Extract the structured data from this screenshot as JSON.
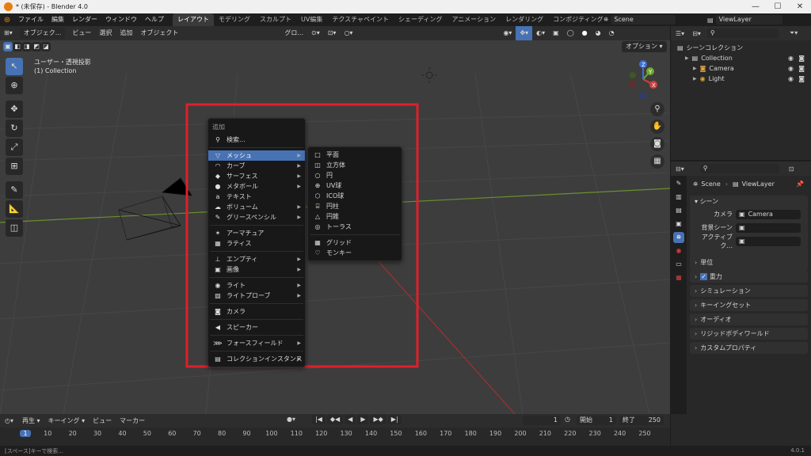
{
  "window": {
    "title": "* (未保存) - Blender 4.0",
    "min_glyph": "—",
    "max_glyph": "☐",
    "close_glyph": "✕"
  },
  "menubar": {
    "menus": [
      "ファイル",
      "編集",
      "レンダー",
      "ウィンドウ",
      "ヘルプ"
    ],
    "workspaces": [
      "レイアウト",
      "モデリング",
      "スカルプト",
      "UV編集",
      "テクスチャペイント",
      "シェーディング",
      "アニメーション",
      "レンダリング",
      "コンポジティング"
    ],
    "active_workspace": "レイアウト",
    "scene": "Scene",
    "view_layer": "ViewLayer"
  },
  "viewport_header": {
    "mode": "オブジェク...",
    "menus": [
      "ビュー",
      "選択",
      "追加",
      "オブジェクト"
    ],
    "transform": "グロ...",
    "options_label": "オプション"
  },
  "viewport": {
    "view_label": "ユーザー・透視投影",
    "collection_label": "(1) Collection",
    "gizmo_axes": [
      "X",
      "Y",
      "Z"
    ]
  },
  "add_menu": {
    "title": "追加",
    "search": "検索...",
    "items": [
      {
        "label": "メッシュ",
        "icon": "▽",
        "sub": true,
        "hl": true
      },
      {
        "label": "カーブ",
        "icon": "◠",
        "sub": true
      },
      {
        "label": "サーフェス",
        "icon": "◆",
        "sub": true
      },
      {
        "label": "メタボール",
        "icon": "●",
        "sub": true
      },
      {
        "label": "テキスト",
        "icon": "a",
        "sub": false
      },
      {
        "label": "ボリューム",
        "icon": "☁",
        "sub": true
      },
      {
        "label": "グリースペンシル",
        "icon": "✎",
        "sub": true
      },
      {
        "label": "アーマチュア",
        "icon": "✶",
        "sub": false
      },
      {
        "label": "ラティス",
        "icon": "▦",
        "sub": false
      },
      {
        "label": "エンプティ",
        "icon": "⊥",
        "sub": true
      },
      {
        "label": "画像",
        "icon": "▣",
        "sub": true
      },
      {
        "label": "ライト",
        "icon": "◉",
        "sub": true
      },
      {
        "label": "ライトプローブ",
        "icon": "▨",
        "sub": true
      },
      {
        "label": "カメラ",
        "icon": "◙",
        "sub": false
      },
      {
        "label": "スピーカー",
        "icon": "◀",
        "sub": false
      },
      {
        "label": "フォースフィールド",
        "icon": "⋙",
        "sub": true
      },
      {
        "label": "コレクションインスタンス",
        "icon": "▤",
        "sub": true
      }
    ]
  },
  "mesh_submenu": {
    "items": [
      {
        "label": "平面",
        "icon": "□"
      },
      {
        "label": "立方体",
        "icon": "◫"
      },
      {
        "label": "円",
        "icon": "○"
      },
      {
        "label": "UV球",
        "icon": "⊕"
      },
      {
        "label": "ICO球",
        "icon": "⬡"
      },
      {
        "label": "円柱",
        "icon": "⌸"
      },
      {
        "label": "円錐",
        "icon": "△"
      },
      {
        "label": "トーラス",
        "icon": "◎"
      },
      {
        "label": "グリッド",
        "icon": "▦"
      },
      {
        "label": "モンキー",
        "icon": "♡"
      }
    ]
  },
  "outliner": {
    "title": "シーンコレクション",
    "items": [
      {
        "label": "Collection",
        "indent": 1
      },
      {
        "label": "Camera",
        "indent": 2
      },
      {
        "label": "Light",
        "indent": 2
      }
    ]
  },
  "properties": {
    "breadcrumb_scene": "Scene",
    "breadcrumb_layer": "ViewLayer",
    "panel_title": "シーン",
    "fields": [
      {
        "label": "カメラ",
        "value": "Camera"
      },
      {
        "label": "背景シーン",
        "value": ""
      },
      {
        "label": "アクティブク...",
        "value": ""
      }
    ],
    "sections": [
      "単位",
      "重力",
      "シミュレーション",
      "キーイングセット",
      "オーディオ",
      "リジッドボディワールド",
      "カスタムプロパティ"
    ]
  },
  "timeline": {
    "menus": [
      "再生",
      "キーイング",
      "ビュー",
      "マーカー"
    ],
    "current_frame": "1",
    "start_label": "開始",
    "start": "1",
    "end_label": "終了",
    "end": "250",
    "ticks": [
      "1",
      "10",
      "20",
      "30",
      "40",
      "50",
      "60",
      "70",
      "80",
      "90",
      "100",
      "110",
      "120",
      "130",
      "140",
      "150",
      "160",
      "170",
      "180",
      "190",
      "200",
      "210",
      "220",
      "230",
      "240",
      "250"
    ]
  },
  "statusbar": {
    "hint": "[スペース]キーで検索...",
    "version": "4.0.1"
  },
  "colors": {
    "accent": "#4772b3",
    "highlight_box": "#e0202a",
    "x_axis": "#d04040",
    "y_axis": "#70a830",
    "z_axis": "#4070d0"
  }
}
